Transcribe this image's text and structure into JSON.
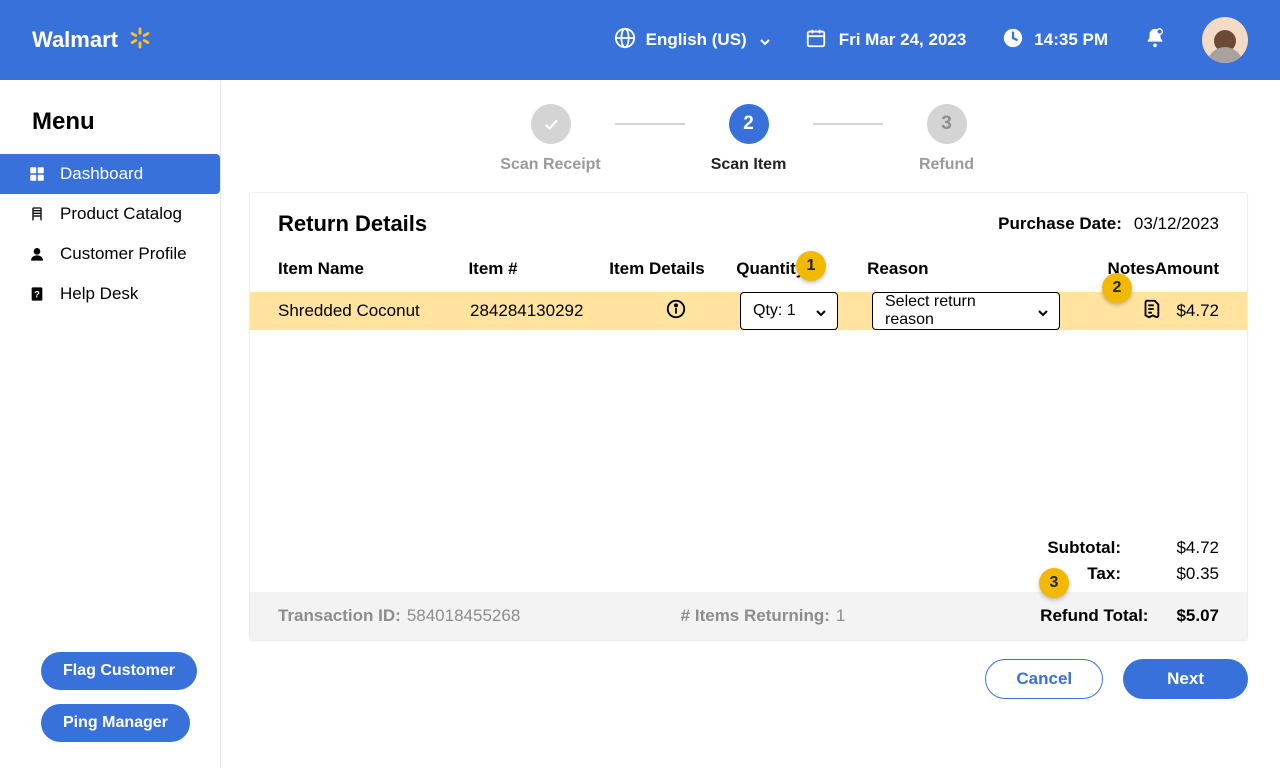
{
  "header": {
    "brand": "Walmart",
    "language": "English (US)",
    "date": "Fri Mar 24, 2023",
    "time": "14:35 PM"
  },
  "sidebar": {
    "title": "Menu",
    "items": [
      {
        "label": "Dashboard"
      },
      {
        "label": "Product Catalog"
      },
      {
        "label": "Customer Profile"
      },
      {
        "label": "Help Desk"
      }
    ],
    "flag_label": "Flag Customer",
    "ping_label": "Ping Manager"
  },
  "stepper": {
    "steps": [
      {
        "label": "Scan Receipt"
      },
      {
        "label": "Scan Item",
        "num": "2"
      },
      {
        "label": "Refund",
        "num": "3"
      }
    ]
  },
  "return": {
    "title": "Return Details",
    "purchase_date_label": "Purchase Date:",
    "purchase_date": "03/12/2023",
    "columns": {
      "name": "Item Name",
      "itemnum": "Item #",
      "details": "Item Details",
      "qty": "Quantity",
      "reason": "Reason",
      "notes": "Notes",
      "amount": "Amount"
    },
    "items": [
      {
        "name": "Shredded Coconut",
        "itemnum": "284284130292",
        "qty_label": "Qty: 1",
        "reason_placeholder": "Select return reason",
        "amount": "$4.72"
      }
    ],
    "totals": {
      "subtotal_label": "Subtotal:",
      "subtotal": "$4.72",
      "tax_label": "Tax:",
      "tax": "$0.35"
    },
    "footer": {
      "txn_label": "Transaction ID:",
      "txn_id": "584018455268",
      "items_label": "# Items Returning:",
      "items_count": "1",
      "refund_label": "Refund Total:",
      "refund_total": "$5.07"
    }
  },
  "actions": {
    "cancel": "Cancel",
    "next": "Next"
  },
  "annotations": {
    "b1": "1",
    "b2": "2",
    "b3": "3"
  }
}
